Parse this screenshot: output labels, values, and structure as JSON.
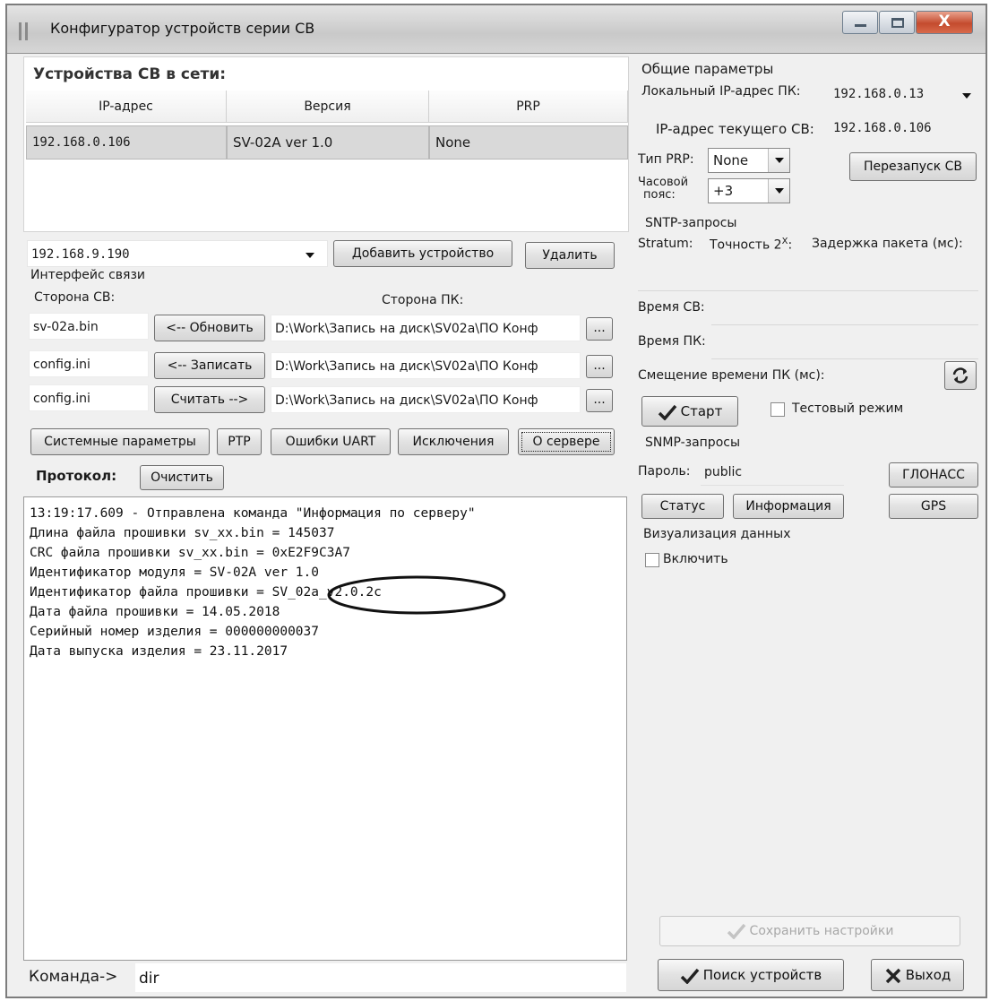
{
  "window": {
    "title": "Конфигуратор устройств серии СВ"
  },
  "devices": {
    "heading": "Устройства СВ в сети:",
    "columns": [
      "IP-адрес",
      "Версия",
      "PRP"
    ],
    "rows": [
      [
        "192.168.0.106",
        "SV-02A ver 1.0",
        "None"
      ]
    ]
  },
  "add_device": {
    "ip_value": "192.168.9.190",
    "add_label": "Добавить устройство",
    "remove_label": "Удалить"
  },
  "comm": {
    "title": "Интерфейс связи",
    "side_sv_label": "Сторона СВ:",
    "side_pc_label": "Сторона ПК:",
    "rows": [
      {
        "file": "sv-02a.bin",
        "action": "<-- Обновить",
        "path": "D:\\Work\\Запись на диск\\SV02a\\ПО Конф"
      },
      {
        "file": "config.ini",
        "action": "<-- Записать",
        "path": "D:\\Work\\Запись на диск\\SV02a\\ПО Конф"
      },
      {
        "file": "config.ini",
        "action": "Считать -->",
        "path": "D:\\Work\\Запись на диск\\SV02a\\ПО Конф"
      }
    ],
    "browse_label": "..."
  },
  "tabs": [
    "Системные параметры",
    "PTP",
    "Ошибки UART",
    "Исключения",
    "О сервере"
  ],
  "protocol": {
    "label": "Протокол:",
    "clear_label": "Очистить",
    "lines": [
      "13:19:17.609 - Отправлена команда \"Информация по серверу\"",
      "Длина файла прошивки sv_xx.bin = 145037",
      "CRC файла прошивки sv_xx.bin = 0xE2F9C3A7",
      "Идентификатор модуля = SV-02A ver 1.0",
      "Идентификатор файла прошивки = SV_02a_v2.0.2c",
      "Дата файла прошивки = 14.05.2018",
      "Серийный номер изделия = 000000000037",
      "Дата выпуска изделия = 23.11.2017"
    ]
  },
  "command": {
    "label": "Команда->",
    "value": "dir"
  },
  "general": {
    "title": "Общие параметры",
    "local_ip_label": "Локальный IP-адрес ПК:",
    "local_ip_value": "192.168.0.13",
    "current_ip_label": "IP-адрес текущего СВ:",
    "current_ip_value": "192.168.0.106",
    "prp_label": "Тип PRP:",
    "prp_value": "None",
    "restart_label": "Перезапуск СВ",
    "tz_label_1": "Часовой",
    "tz_label_2": "пояс:",
    "tz_value": "+3"
  },
  "sntp": {
    "title": "SNTP-запросы",
    "stratum_label": "Stratum:",
    "precision_label": "Точность 2",
    "precision_sup": "X",
    "precision_colon": ":",
    "delay_label": "Задержка пакета (мс):",
    "sv_time_label": "Время СВ:",
    "pc_time_label": "Время ПК:",
    "offset_label": "Смещение времени ПК (мс):",
    "start_label": "Старт",
    "test_mode_label": "Тестовый режим"
  },
  "snmp": {
    "title": "SNMP-запросы",
    "password_label": "Пароль:",
    "password_value": "public",
    "glonass_label": "ГЛОНАСС",
    "status_label": "Статус",
    "info_label": "Информация",
    "gps_label": "GPS"
  },
  "visualization": {
    "title": "Визуализация данных",
    "enable_label": "Включить"
  },
  "footer": {
    "save_label": "Сохранить настройки",
    "search_label": "Поиск устройств",
    "exit_label": "Выход"
  }
}
